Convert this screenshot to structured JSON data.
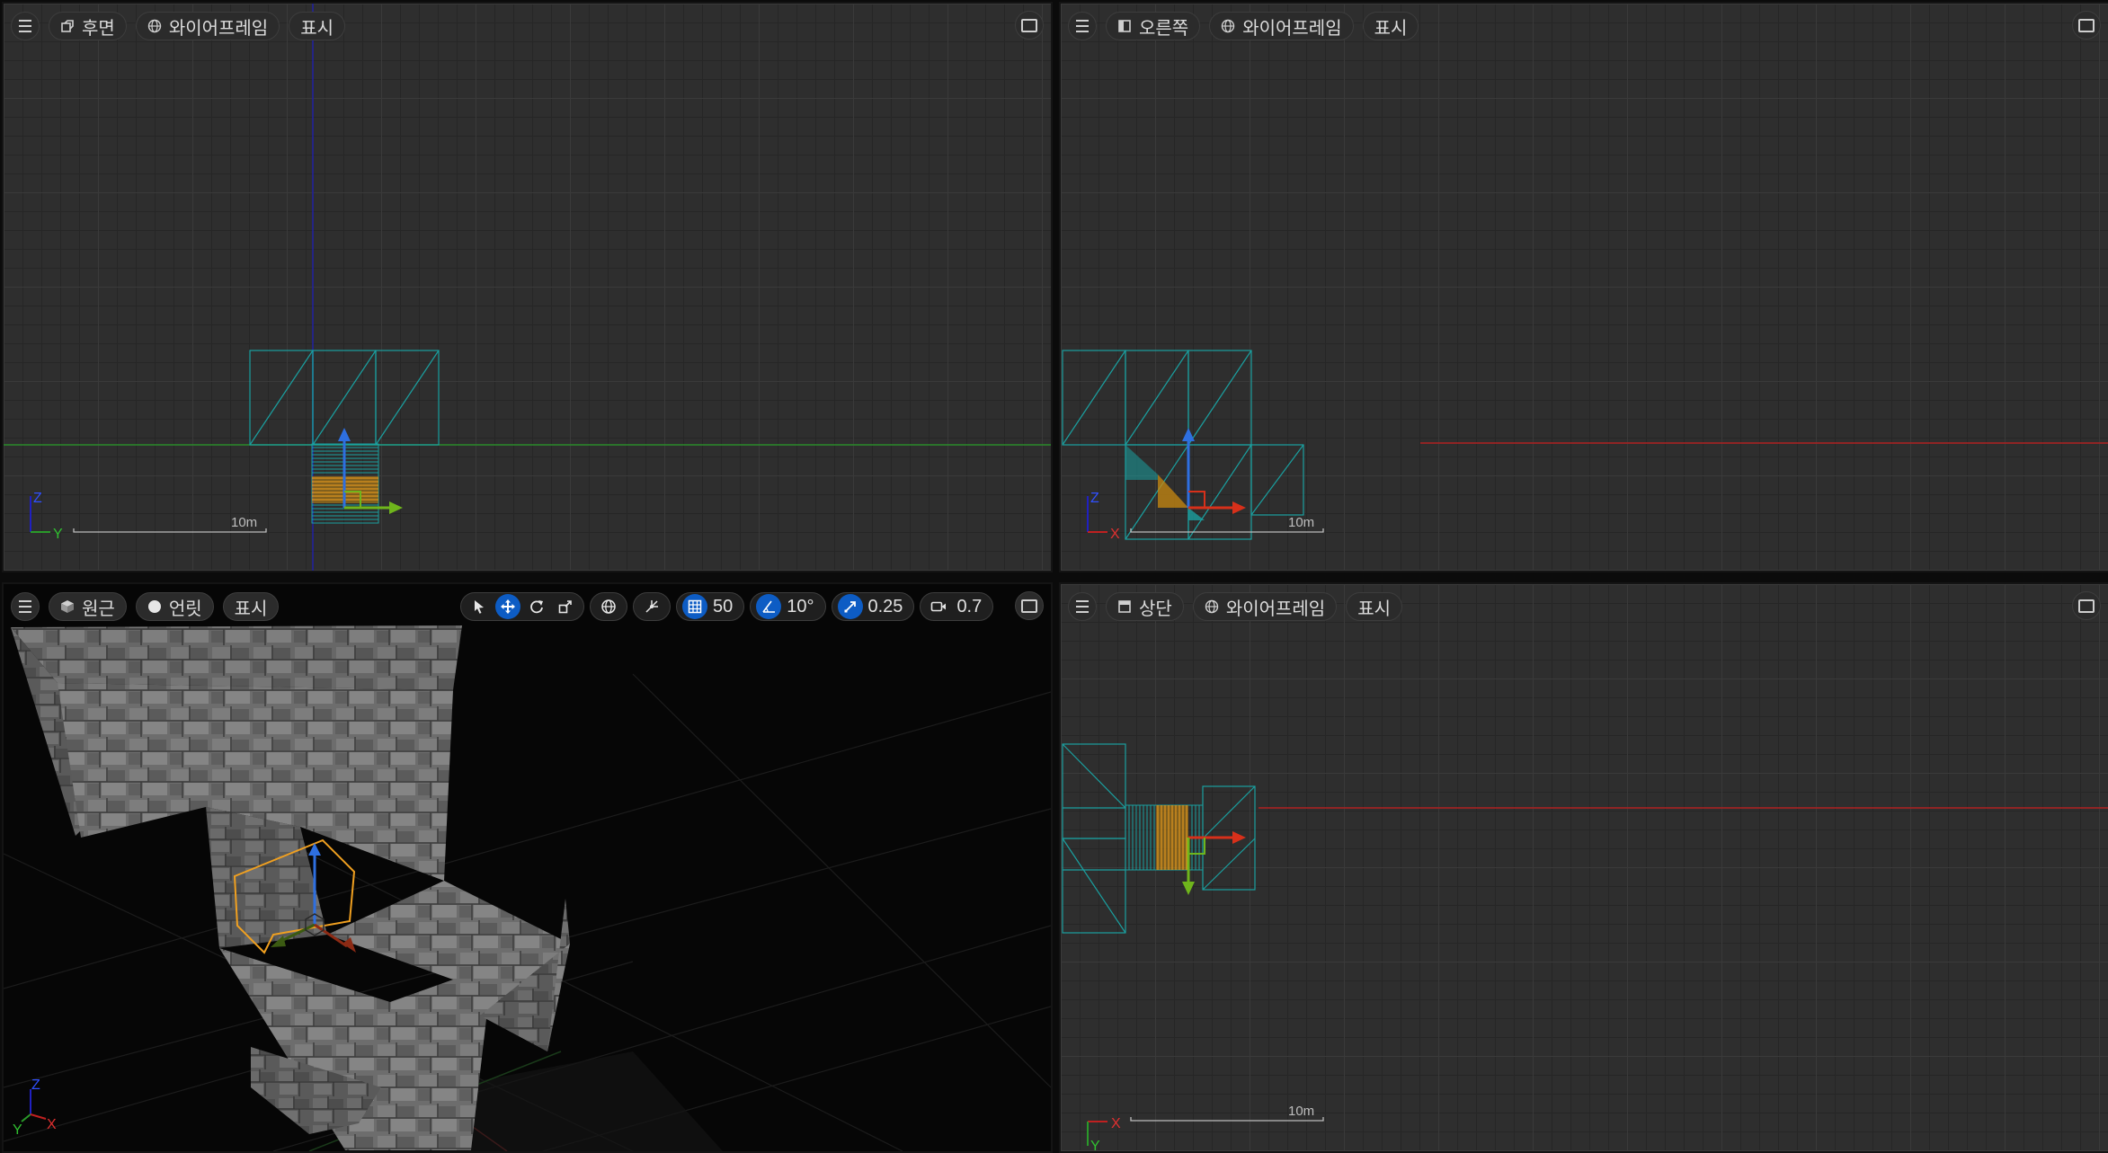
{
  "viewports": {
    "back": {
      "view_label": "후면",
      "shading_label": "와이어프레임",
      "show_label": "표시",
      "axis_labels": [
        "Z",
        "Y"
      ],
      "scale_label": "10m"
    },
    "right": {
      "view_label": "오른쪽",
      "shading_label": "와이어프레임",
      "show_label": "표시",
      "axis_labels": [
        "Z",
        "X"
      ],
      "scale_label": "10m"
    },
    "perspective": {
      "view_label": "원근",
      "shading_label": "언릿",
      "show_label": "표시",
      "axis_labels": [
        "Z",
        "Y",
        "X"
      ],
      "toolbar": {
        "grid_snap_value": "50",
        "rotation_snap_value": "10°",
        "scale_snap_value": "0.25",
        "camera_speed_value": "0.7"
      }
    },
    "top": {
      "view_label": "상단",
      "shading_label": "와이어프레임",
      "show_label": "표시",
      "axis_labels": [
        "X",
        "Y"
      ],
      "scale_label": "10m"
    }
  },
  "icons": {
    "menu": "hamburger-icon",
    "maximize": "maximize-icon",
    "back_view": "back-view-icon",
    "right_view": "right-view-icon",
    "perspective_view": "perspective-cube-icon",
    "unlit": "unlit-sphere-icon",
    "wireframe": "wireframe-globe-icon",
    "select": "select-arrow-icon",
    "translate": "translate-icon",
    "rotate": "rotate-icon",
    "scale": "scale-icon",
    "world": "world-space-icon",
    "surface_snap": "surface-snap-icon",
    "grid_snap": "grid-snap-icon",
    "rotation_snap": "angle-snap-icon",
    "scale_snap": "scale-snap-icon",
    "camera": "camera-icon"
  },
  "colors": {
    "wire": "#1aa0a0",
    "selected": "#f0a020",
    "axis_x": "#d7301a",
    "axis_y": "#6fb51c",
    "axis_z": "#2e6fe0",
    "active_tool": "#0d5cc4"
  }
}
